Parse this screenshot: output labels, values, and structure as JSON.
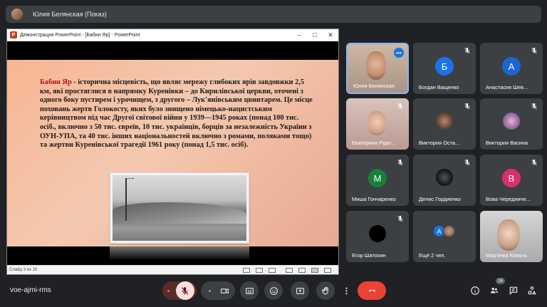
{
  "presenter_bar": {
    "title": "Юлия Белянская (Показ)"
  },
  "ppt_window": {
    "title": "Демонстрация PowerPoint - [Бабин Яр] - PowerPoint",
    "slide": {
      "highlight": "Бабин Яр",
      "body": " - історична місцевість, що являє мережу глибоких ярів завдовжки 2,5 км, які простяглися в напрямку Куренівки – до Кирилівської церкви, оточені з одного боку пустирем і урочищем, з другого – Лук'янівським цвинтарем. Це місце поховань жертв Голокосту, яких було знищено німецько-нацистським керівництвом під час Другої світової війни у 1939—1945 роках (понад 100 тис. осіб., включно з 50 тис. євреїв, 10 тис. українців, борців за незалежність України з ОУН-УПА, та 40 тис. інших національностей включно з ромами, поляками тощо) та жертви Куренівської трагедії 1961 року (понад 1,5 тис. осіб)."
    },
    "statusbar": {
      "slide_counter": "Слайд 3 из 10"
    }
  },
  "participants": [
    {
      "name": "Юлия Белянская",
      "type": "video"
    },
    {
      "name": "Богдан Ващенко",
      "initial": "Б",
      "color": "#1a73e8"
    },
    {
      "name": "Анастасия Шев...",
      "initial": "А",
      "color": "#1967d2"
    },
    {
      "name": "Екатерина Рудн...",
      "type": "video"
    },
    {
      "name": "Виктория Оста...",
      "type": "photo"
    },
    {
      "name": "Виктория Васина",
      "type": "photo"
    },
    {
      "name": "Миша Гончаренко",
      "initial": "М",
      "color": "#188038"
    },
    {
      "name": "Денис Гордиенко",
      "type": "photo"
    },
    {
      "name": "Вова Чередниче...",
      "initial": "В",
      "color": "#d93069"
    },
    {
      "name": "Егор Шатохин",
      "type": "photo"
    },
    {
      "name": "Ещё 2 чел.",
      "more_initial": "А"
    },
    {
      "name": "Мар'янка Коваль",
      "type": "video"
    }
  ],
  "bottom_bar": {
    "meeting_code": "voe-ajmi-rms",
    "people_count": "16"
  },
  "colors": {
    "background": "#202124",
    "tile": "#3c4043",
    "end_call": "#ea4335",
    "mic_off": "#f9dedc"
  }
}
